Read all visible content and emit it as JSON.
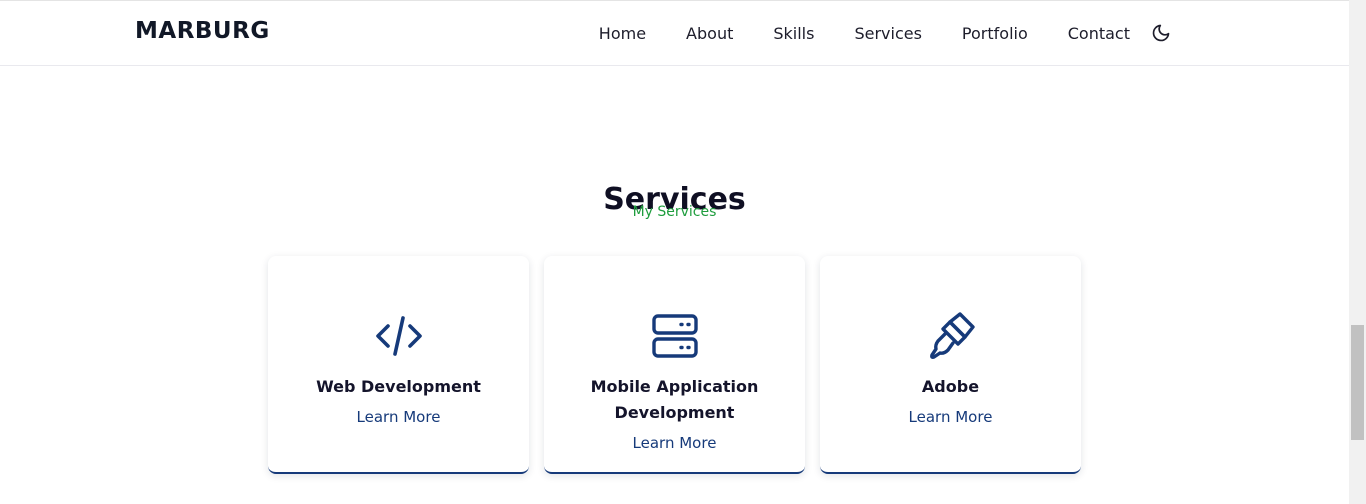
{
  "header": {
    "logo": "MARBURG",
    "nav": [
      "Home",
      "About",
      "Skills",
      "Services",
      "Portfolio",
      "Contact"
    ],
    "theme_icon": "moon-icon"
  },
  "section": {
    "title": "Services",
    "subtitle": "My Services"
  },
  "cards": [
    {
      "icon": "code-icon",
      "title": "Web Development",
      "link": "Learn More"
    },
    {
      "icon": "server-icon",
      "title": "Mobile Application Development",
      "link": "Learn More"
    },
    {
      "icon": "brush-icon",
      "title": "Adobe",
      "link": "Learn More"
    }
  ],
  "colors": {
    "accent": "#163a7a",
    "subtitle": "#1f9d3e",
    "text": "#0f0f23"
  }
}
